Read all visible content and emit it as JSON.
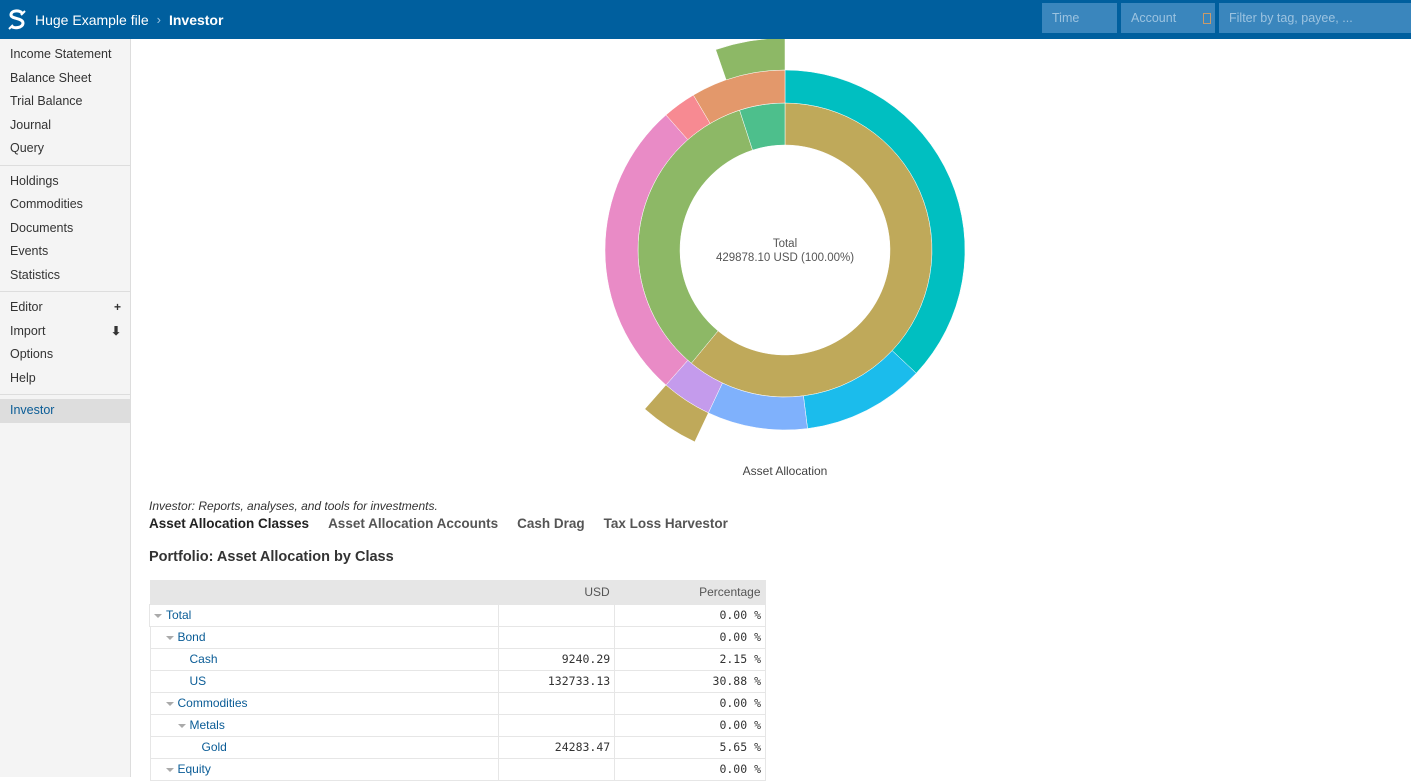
{
  "header": {
    "file_name": "Huge Example file",
    "separator": "›",
    "current_page": "Investor",
    "filters": {
      "time_placeholder": "Time",
      "account_placeholder": "Account",
      "filter_placeholder": "Filter by tag, payee, ..."
    }
  },
  "sidebar": {
    "groups": [
      [
        {
          "label": "Income Statement"
        },
        {
          "label": "Balance Sheet"
        },
        {
          "label": "Trial Balance"
        },
        {
          "label": "Journal"
        },
        {
          "label": "Query"
        }
      ],
      [
        {
          "label": "Holdings"
        },
        {
          "label": "Commodities"
        },
        {
          "label": "Documents"
        },
        {
          "label": "Events"
        },
        {
          "label": "Statistics"
        }
      ],
      [
        {
          "label": "Editor",
          "extra": "+"
        },
        {
          "label": "Import",
          "extra": "⬇"
        },
        {
          "label": "Options"
        },
        {
          "label": "Help"
        }
      ],
      [
        {
          "label": "Investor",
          "active": true
        }
      ]
    ]
  },
  "chart_data": {
    "type": "sunburst",
    "title": "Asset Allocation",
    "center_label": "Total",
    "center_value": "429878.10 USD (100.00%)",
    "rings": [
      [
        {
          "name": "segment-1",
          "start": 0.0,
          "end": 0.61,
          "color": "#bfa95a"
        },
        {
          "name": "segment-2",
          "start": 0.61,
          "end": 0.95,
          "color": "#8db866"
        },
        {
          "name": "segment-3",
          "start": 0.95,
          "end": 1.0,
          "color": "#4dbf8c"
        }
      ],
      [
        {
          "name": "segment-4",
          "start": 0.0,
          "end": 0.37,
          "color": "#00bfc1"
        },
        {
          "name": "segment-5",
          "start": 0.37,
          "end": 0.48,
          "color": "#1bbcec"
        },
        {
          "name": "segment-6",
          "start": 0.48,
          "end": 0.57,
          "color": "#7fb1fc"
        },
        {
          "name": "segment-7",
          "start": 0.57,
          "end": 0.615,
          "color": "#c49bec"
        },
        {
          "name": "segment-8",
          "start": 0.615,
          "end": 0.885,
          "color": "#e98bc6"
        },
        {
          "name": "segment-9",
          "start": 0.885,
          "end": 0.915,
          "color": "#f78a92"
        },
        {
          "name": "segment-10",
          "start": 0.915,
          "end": 1.0,
          "color": "#e3986b"
        }
      ],
      [
        {
          "name": "segment-11",
          "start": 0.57,
          "end": 0.615,
          "color": "#bfa95a"
        },
        {
          "name": "segment-12",
          "start": 0.947,
          "end": 1.0,
          "color": "#8db866"
        }
      ]
    ]
  },
  "main": {
    "description": "Investor: Reports, analyses, and tools for investments.",
    "tabs": [
      {
        "label": "Asset Allocation Classes",
        "active": true
      },
      {
        "label": "Asset Allocation Accounts"
      },
      {
        "label": "Cash Drag"
      },
      {
        "label": "Tax Loss Harvestor"
      }
    ],
    "section_title": "Portfolio: Asset Allocation by Class",
    "table": {
      "columns": [
        "",
        "USD",
        "Percentage"
      ],
      "rows": [
        {
          "name": "Total",
          "level": 0,
          "expandable": true,
          "usd": "",
          "pct": "0.00 %"
        },
        {
          "name": "Bond",
          "level": 1,
          "expandable": true,
          "usd": "",
          "pct": "0.00 %"
        },
        {
          "name": "Cash",
          "level": 2,
          "expandable": false,
          "usd": "9240.29",
          "pct": "2.15 %"
        },
        {
          "name": "US",
          "level": 2,
          "expandable": false,
          "usd": "132733.13",
          "pct": "30.88 %"
        },
        {
          "name": "Commodities",
          "level": 1,
          "expandable": true,
          "usd": "",
          "pct": "0.00 %"
        },
        {
          "name": "Metals",
          "level": 2,
          "expandable": true,
          "usd": "",
          "pct": "0.00 %"
        },
        {
          "name": "Gold",
          "level": 3,
          "expandable": false,
          "usd": "24283.47",
          "pct": "5.65 %"
        },
        {
          "name": "Equity",
          "level": 1,
          "expandable": true,
          "usd": "",
          "pct": "0.00 %"
        }
      ]
    }
  }
}
